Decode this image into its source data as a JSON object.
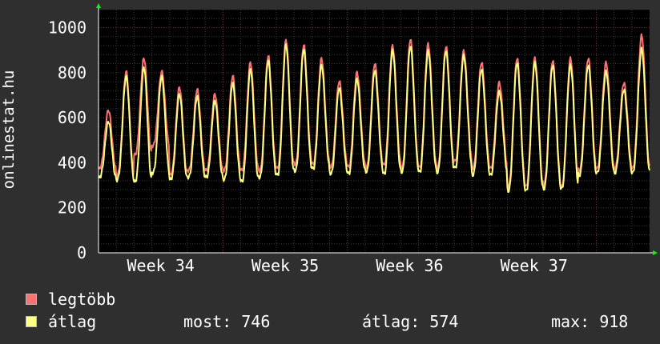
{
  "chart_data": {
    "type": "line",
    "ylabel": "onlinestat.hu",
    "ylim": [
      0,
      1080
    ],
    "yticks": [
      0,
      200,
      400,
      600,
      800,
      1000
    ],
    "xticks": [
      "Week 34",
      "Week 35",
      "Week 36",
      "Week 37"
    ],
    "x_range_days": [
      0,
      31
    ],
    "xtick_positions_days": [
      3.5,
      10.5,
      17.5,
      24.5
    ],
    "grid": true,
    "series": [
      {
        "name": "legtöbb",
        "color": "#ff7070",
        "daily_peaks": [
          630,
          800,
          860,
          800,
          730,
          720,
          700,
          780,
          840,
          870,
          940,
          920,
          860,
          760,
          800,
          840,
          920,
          950,
          930,
          920,
          900,
          850,
          760,
          870,
          870,
          860,
          870,
          870,
          850,
          760,
          970
        ],
        "daily_troughs": [
          370,
          340,
          430,
          470,
          340,
          360,
          360,
          360,
          360,
          360,
          370,
          390,
          390,
          380,
          380,
          380,
          390,
          380,
          380,
          380,
          410,
          380,
          380,
          300,
          300,
          310,
          300,
          370,
          380,
          380,
          380
        ]
      },
      {
        "name": "átlag",
        "color": "#ffff80",
        "daily_peaks": [
          580,
          780,
          820,
          780,
          700,
          690,
          670,
          750,
          810,
          850,
          920,
          900,
          830,
          730,
          770,
          810,
          900,
          920,
          900,
          900,
          880,
          820,
          720,
          850,
          850,
          840,
          840,
          840,
          810,
          730,
          910
        ],
        "daily_troughs": [
          330,
          320,
          310,
          350,
          320,
          330,
          330,
          320,
          310,
          330,
          340,
          360,
          370,
          350,
          350,
          360,
          350,
          360,
          360,
          360,
          380,
          350,
          350,
          280,
          280,
          290,
          290,
          350,
          360,
          360,
          360
        ]
      }
    ]
  },
  "legend": {
    "max_label": "legtöbb",
    "avg_label": "átlag",
    "stats": {
      "now": "most: 746",
      "avg": "átlag: 574",
      "max": "max: 918"
    }
  }
}
